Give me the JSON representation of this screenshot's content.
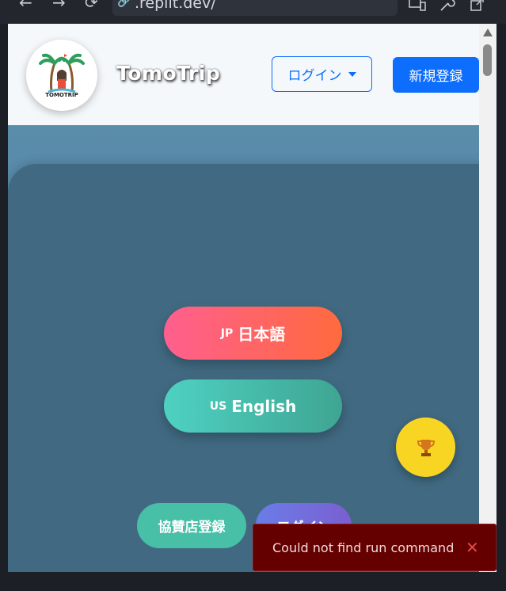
{
  "browser": {
    "url_text": ".replit.dev/",
    "back_icon": "←",
    "forward_icon": "→",
    "reload_icon": "⟳"
  },
  "header": {
    "brand": "TomoTrip",
    "logo_text": "TOMOTRIP",
    "login_label": "ログイン",
    "register_label": "新規登録"
  },
  "hero": {
    "languages": [
      {
        "code": "JP",
        "label": "日本語"
      },
      {
        "code": "US",
        "label": "English"
      }
    ],
    "sponsor_label": "協賛店登録",
    "login_pill_label": "ログイン"
  },
  "toast": {
    "message": "Could not find run command",
    "close_icon": "✕"
  },
  "colors": {
    "primary": "#0d6efd",
    "toast_bg": "#640000",
    "trophy_bg": "#f9d523"
  }
}
